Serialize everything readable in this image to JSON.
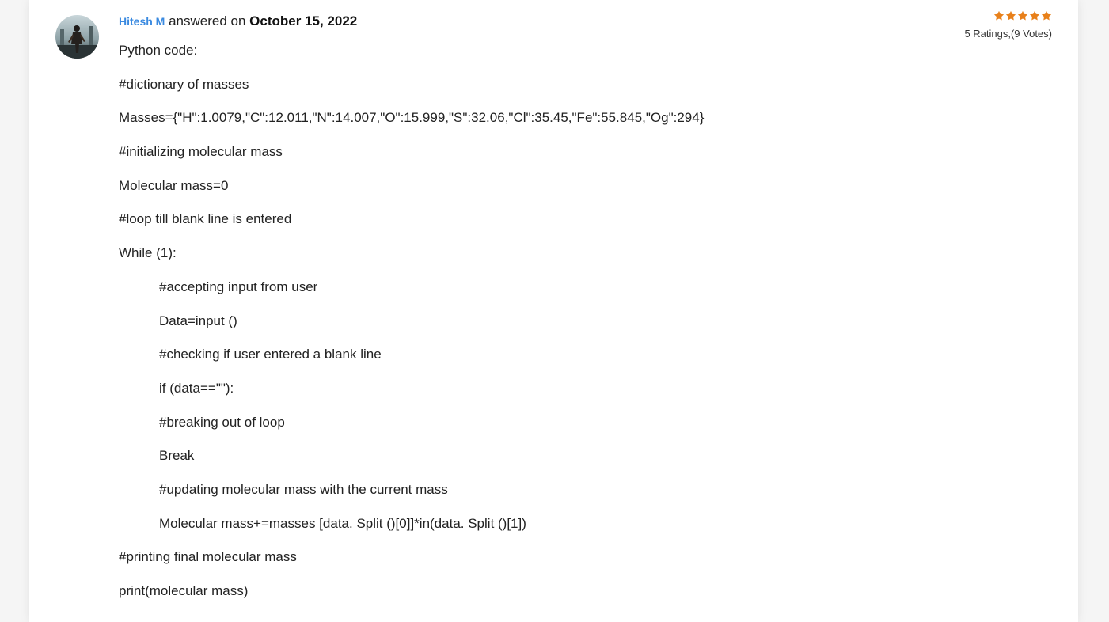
{
  "answer": {
    "author": "Hitesh M",
    "answered_label": "answered on",
    "date": "October 15, 2022",
    "rating": {
      "stars": 5,
      "star_color": "#e8801a",
      "text": "5 Ratings,(9 Votes)"
    },
    "lines": [
      {
        "text": "Python code:",
        "indent": false
      },
      {
        "text": "#dictionary of masses",
        "indent": false
      },
      {
        "text": "Masses={\"H\":1.0079,\"C\":12.011,\"N\":14.007,\"O\":15.999,\"S\":32.06,\"Cl\":35.45,\"Fe\":55.845,\"Og\":294}",
        "indent": false
      },
      {
        "text": "#initializing molecular mass",
        "indent": false
      },
      {
        "text": "Molecular mass=0",
        "indent": false
      },
      {
        "text": "#loop till blank line is entered",
        "indent": false
      },
      {
        "text": "While (1):",
        "indent": false
      },
      {
        "text": "#accepting input from user",
        "indent": true
      },
      {
        "text": "Data=input ()",
        "indent": true
      },
      {
        "text": "#checking if user entered a blank line",
        "indent": true
      },
      {
        "text": "if (data==\"\"):",
        "indent": true
      },
      {
        "text": "#breaking out of loop",
        "indent": true
      },
      {
        "text": "Break",
        "indent": true
      },
      {
        "text": "#updating molecular mass with the current mass",
        "indent": true
      },
      {
        "text": "Molecular mass+=masses [data. Split ()[0]]*in(data. Split ()[1])",
        "indent": true
      },
      {
        "text": "#printing final molecular mass",
        "indent": false
      },
      {
        "text": "print(molecular mass)",
        "indent": false
      }
    ]
  },
  "colors": {
    "author_link": "#3a8ae0",
    "star": "#e8801a"
  },
  "icons": {
    "avatar": "user-avatar",
    "star": "star-icon"
  }
}
